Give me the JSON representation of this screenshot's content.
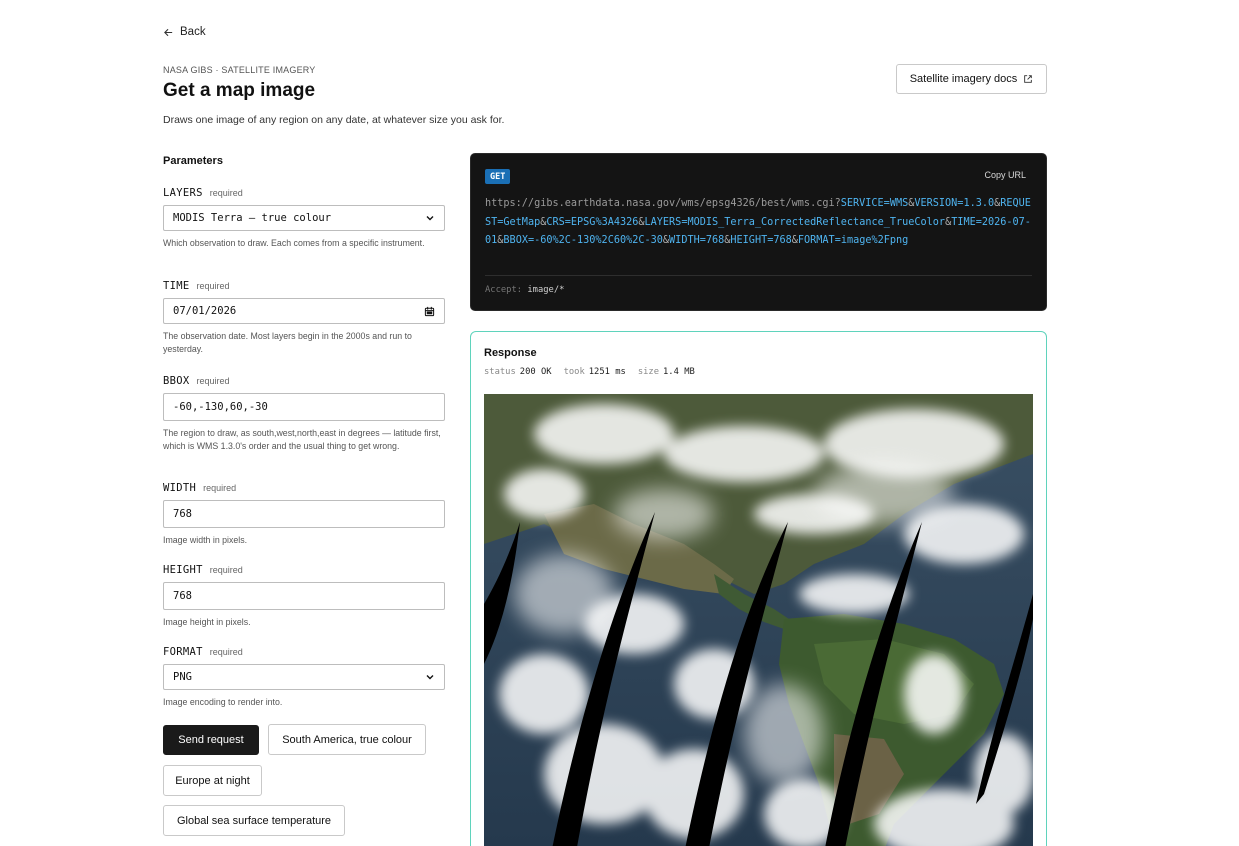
{
  "nav": {
    "back_label": "Back"
  },
  "header": {
    "eyebrow": "NASA GIBS · SATELLITE IMAGERY",
    "title": "Get a map image",
    "subtitle": "Draws one image of any region on any date, at whatever size you ask for.",
    "docs_button": "Satellite imagery docs"
  },
  "params": {
    "heading": "Parameters",
    "fields": [
      {
        "name": "LAYERS",
        "required": "required",
        "value": "MODIS Terra — true colour",
        "help": "Which observation to draw. Each comes from a specific instrument."
      },
      {
        "name": "TIME",
        "required": "required",
        "value": "07/01/2026",
        "help": "The observation date. Most layers begin in the 2000s and run to yesterday."
      },
      {
        "name": "BBOX",
        "required": "required",
        "value": "-60,-130,60,-30",
        "help": "The region to draw, as south,west,north,east in degrees — latitude first, which is WMS 1.3.0's order and the usual thing to get wrong."
      },
      {
        "name": "WIDTH",
        "required": "required",
        "value": "768",
        "help": "Image width in pixels."
      },
      {
        "name": "HEIGHT",
        "required": "required",
        "value": "768",
        "help": "Image height in pixels."
      },
      {
        "name": "FORMAT",
        "required": "required",
        "value": "PNG",
        "help": "Image encoding to render into."
      }
    ]
  },
  "actions": {
    "send": "Send request",
    "preset_1": "South America, true colour",
    "preset_2": "Europe at night",
    "preset_3": "Global sea surface temperature"
  },
  "request": {
    "method": "GET",
    "copy_label": "Copy URL",
    "url_base": "https://gibs.earthdata.nasa.gov/wms/epsg4326/best/wms.cgi?",
    "url_query": "SERVICE=WMS&VERSION=1.3.0&REQUEST=GetMap&CRS=EPSG%3A4326&LAYERS=MODIS_Terra_CorrectedReflectance_TrueColor&TIME=2026-07-01&BBOX=-60%2C-130%2C60%2C-30&WIDTH=768&HEIGHT=768&FORMAT=image%2Fpng",
    "accept_label": "Accept:",
    "accept_value": "image/*"
  },
  "response": {
    "title": "Response",
    "status_label": "status",
    "status_value": "200 OK",
    "took_label": "took",
    "took_value": "1251 ms",
    "size_label": "size",
    "size_value": "1.4 MB"
  },
  "colors": {
    "accent_border": "#5fd3bc",
    "get_badge": "#1a6fb5",
    "url_param": "#4fb4f0"
  },
  "icons": [
    "arrow-left-icon",
    "external-link-icon",
    "chevron-down-icon",
    "calendar-icon"
  ]
}
